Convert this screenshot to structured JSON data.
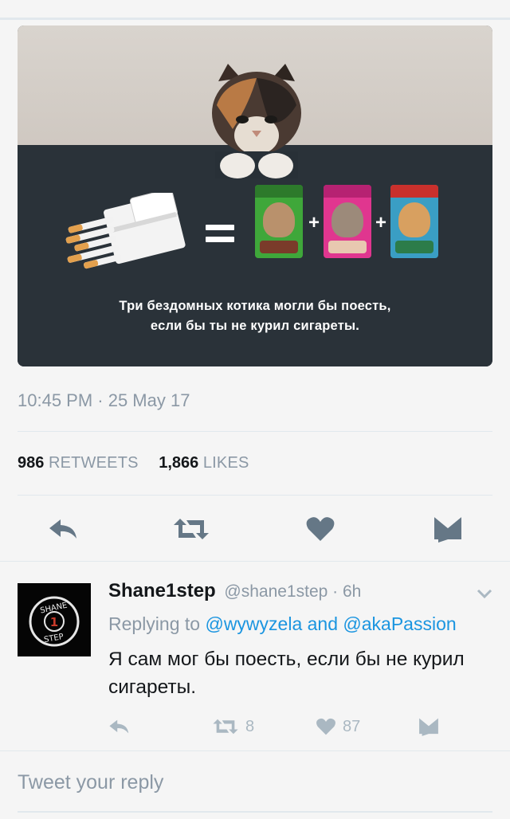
{
  "media": {
    "caption_line1": "Три бездомных котика могли бы поесть,",
    "caption_line2": "если бы ты не курил сигареты."
  },
  "tweet": {
    "timestamp": "10:45 PM · 25 May 17",
    "retweets_count": "986",
    "retweets_label": "RETWEETS",
    "likes_count": "1,866",
    "likes_label": "LIKES"
  },
  "actions": {
    "reply_icon": "reply-icon",
    "retweet_icon": "retweet-icon",
    "like_icon": "heart-icon",
    "dm_icon": "envelope-icon"
  },
  "reply": {
    "avatar_text_top": "SHANE",
    "avatar_text_mid": "1",
    "avatar_text_bottom": "STEP",
    "name": "Shane1step",
    "handle_time": "@shane1step · 6h",
    "replying_prefix": "Replying to",
    "mention1": "@wywyzela",
    "and": "and",
    "mention2": "@akaPassion",
    "text": "Я сам мог бы поесть, если бы не курил сигареты.",
    "retweet_count": "8",
    "like_count": "87"
  },
  "compose": {
    "placeholder": "Tweet your reply"
  },
  "colors": {
    "link": "#1b95e0",
    "muted": "#8b98a5",
    "icon": "#657786",
    "icon_light": "#aab8c2"
  }
}
